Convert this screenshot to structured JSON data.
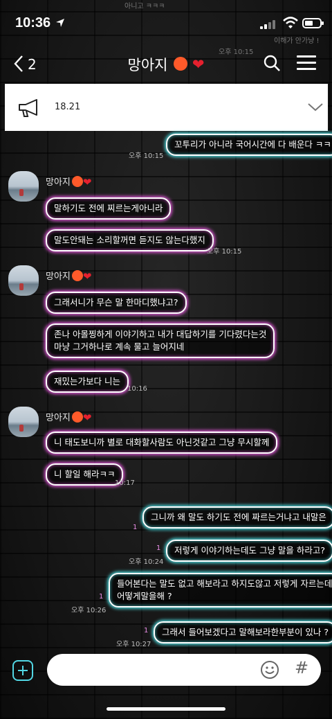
{
  "status_bar": {
    "time": "10:36"
  },
  "nav": {
    "back_count": "2",
    "title": "망아지"
  },
  "notice": {
    "text": "18.21"
  },
  "background_fragments": {
    "top_left": "아니고 ㅋㅋㅋ",
    "top_right": "이해가 안가냥 !",
    "time_ghost": "오후 10:15"
  },
  "sender_name": "망아지",
  "messages": [
    {
      "text": "꼬투리가 아니라 국어시간에 다 배운다 ㅋㅋ",
      "time": "오후 10:15"
    },
    {
      "text": "말하기도 전에 찌르는게아니라"
    },
    {
      "text": "말도안돼는 소리할꺼면 듣지도 않는다했지",
      "time": "오후 10:15"
    },
    {
      "text": "그래서니가 무슨 말 한마디했냐고?"
    },
    {
      "line1": "존나 아몰찡하게 이야기하고 내가 대답하기를 기다렸다는것",
      "line2": "마냥 그거하나로 계속 물고 늘어지네"
    },
    {
      "text": "재밌는가보다 니는",
      "time": "10:16"
    },
    {
      "text": "니 태도보니까 별로 대화할사람도 아닌것같고 그냥 무시할께"
    },
    {
      "text": "니 할일 해라ㅋㅋ",
      "time": "10:17"
    },
    {
      "text": "그니까 왜 말도 하기도 전에 짜르는거냐고 내말은",
      "unread": "1"
    },
    {
      "text": "저렇게 이야기하는데도 그냥 말을 하라고?",
      "unread": "1",
      "time": "오후 10:24"
    },
    {
      "line1": "들어본다는 말도 없고 해보라고 하지도않고 저렇게 자르는데",
      "line2": "어떻게말을해 ?",
      "unread": "1",
      "time": "오후 10:26"
    },
    {
      "text": "그래서 들어보겠다고 말해보라한부분이 있나 ?",
      "unread": "1",
      "time": "오후 10:27"
    }
  ],
  "input": {
    "placeholder": "",
    "hash": "#"
  },
  "colors": {
    "sent_glow": "#50ebf0",
    "received_glow": "#f05ae6",
    "plus_accent": "#52d7e4"
  }
}
